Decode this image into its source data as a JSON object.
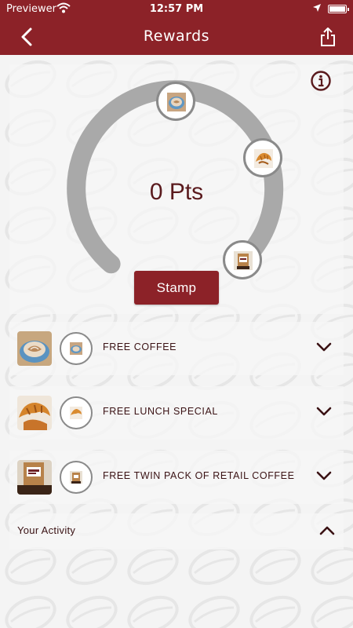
{
  "status_bar": {
    "carrier": "Previewer",
    "time": "12:57 PM",
    "battery_level": 1.0
  },
  "nav": {
    "title": "Rewards",
    "back_icon": "chevron-left-icon",
    "share_icon": "share-icon"
  },
  "rewards": {
    "points_label": "0 Pts",
    "stamp_label": "Stamp",
    "info_icon": "info-icon"
  },
  "reward_items": [
    {
      "label": "FREE COFFEE",
      "icon": "coffee-cup-image"
    },
    {
      "label": "FREE LUNCH SPECIAL",
      "icon": "croissant-image"
    },
    {
      "label": "FREE TWIN PACK OF RETAIL COFFEE",
      "icon": "coffee-bag-image"
    }
  ],
  "activity": {
    "label": "Your Activity"
  },
  "colors": {
    "brand": "#8c2228",
    "text_dark": "#3a1214",
    "ring": "#a9a9a9",
    "background": "#f4f4f4"
  }
}
